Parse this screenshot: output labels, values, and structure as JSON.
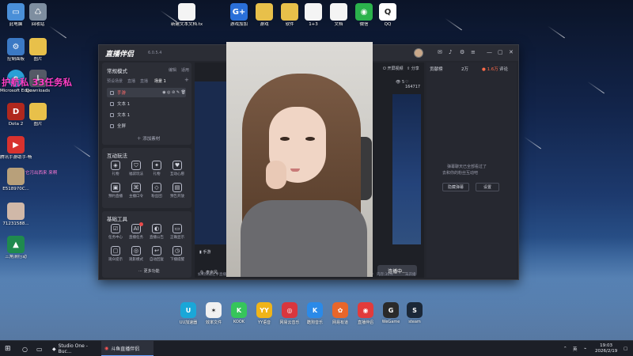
{
  "desktop": {
    "icons": [
      {
        "label": "此电脑",
        "color": "#4a8fd8"
      },
      {
        "label": "回收站",
        "color": "#c8d4e0"
      },
      {
        "label": "控制面板",
        "color": "#3b79c4"
      },
      {
        "label": "图片",
        "color": "#e8c04a"
      },
      {
        "label": "Microsoft Edge",
        "color": "#2a9fd6"
      },
      {
        "label": "Downloads",
        "color": "#555a66"
      },
      {
        "label": "Dota 2",
        "color": "#b0281e"
      },
      {
        "label": "图片",
        "color": "#e8c04a"
      },
      {
        "label": "腾讯手游助手-畅玩手机...",
        "color": "#d8322e"
      },
      {
        "label": "E518970C...",
        "color": "#b8a07a"
      },
      {
        "label": "71231588...",
        "color": "#d0b8a8"
      },
      {
        "label": "三角洲行动",
        "color": "#1f8a4e"
      },
      {
        "label": "新建文本文档.txt",
        "color": "#f4f4f4"
      },
      {
        "label": "游戏加加",
        "color": "#2a6fd8"
      },
      {
        "label": "游戏",
        "color": "#e8c04a"
      },
      {
        "label": "软件",
        "color": "#e8c04a"
      },
      {
        "label": "1+3",
        "color": "#f4f4f4"
      },
      {
        "label": "文档",
        "color": "#f4f4f4"
      },
      {
        "label": "微信",
        "color": "#2bb24c"
      },
      {
        "label": "QQ",
        "color": "#222222"
      }
    ],
    "overlay_text": "护航私 33任务私",
    "overlay_text_2": "它污出西来 来啊"
  },
  "window": {
    "app_name": "直播伴侣",
    "version": "6.0.5.4",
    "title_icons": [
      "message-icon",
      "bell-icon",
      "settings-icon",
      "menu-icon",
      "minimize-icon",
      "maximize-icon",
      "close-icon"
    ],
    "left": {
      "mode_label": "常规模式",
      "edit": "编辑",
      "layout": "适用",
      "scene_tabs": [
        "预设场景",
        "直播",
        "直播",
        "场景 1"
      ],
      "sources": [
        {
          "name": "手游",
          "selected": true
        },
        {
          "name": "文本 1",
          "selected": false
        },
        {
          "name": "文本 1",
          "selected": false
        },
        {
          "name": "全屏",
          "selected": false
        }
      ],
      "add_material": "添加素材",
      "interact_title": "互动玩法",
      "interact_tools": [
        "礼物",
        "福袋玩法",
        "礼物",
        "互动心愿",
        "预约直播",
        "主播口令",
        "粉丝团",
        "预告开放"
      ],
      "basic_title": "基础工具",
      "basic_tools": [
        "任务中心",
        "直播任务",
        "直播公告",
        "正确显示",
        "观众提示",
        "观影模式",
        "自动回复",
        "下播提醒"
      ],
      "more": "更多功能"
    },
    "center": {
      "top_right_labels": [
        "开屏视频",
        "分享"
      ],
      "viewer_count": "5",
      "like_count": "164717",
      "mic_label": "手游",
      "speaker_label": "麦克风",
      "go_live": "连播中...",
      "status": [
        "如何快速上手直播伴侣？",
        "码率：0kb/s",
        "FPS:60",
        "丢帧:0.00%",
        "CPU:8%",
        "内存:30%",
        "未开播"
      ]
    },
    "right": {
      "header": "贡献榜",
      "rank": "2万",
      "fans": "1.6万",
      "comments": "评论",
      "empty_msg": "弹幕聊天已全部看过了",
      "empty_msg_2": "去和你的粉丝互动吧",
      "btn_a": "隐藏弹幕",
      "btn_b": "设置"
    }
  },
  "dock": [
    {
      "label": "UU加速器",
      "color": "#1aa7d8"
    },
    {
      "label": "效率文件",
      "color": "#f1f1f1"
    },
    {
      "label": "KOOK",
      "color": "#36c55b"
    },
    {
      "label": "YY语音",
      "color": "#f0b418"
    },
    {
      "label": "网易云音乐",
      "color": "#d9363e"
    },
    {
      "label": "酷狗音乐",
      "color": "#2b8ae8"
    },
    {
      "label": "网易有道",
      "color": "#e8662a"
    },
    {
      "label": "直播伴侣",
      "color": "#e23b3b"
    },
    {
      "label": "WeGame",
      "color": "#2a2a2a"
    },
    {
      "label": "steam",
      "color": "#1b2838"
    }
  ],
  "taskbar": {
    "apps": [
      {
        "label": "Studio One - Buc...",
        "active": false
      },
      {
        "label": "斗鱼直播伴侣",
        "active": true
      }
    ],
    "lang": "英",
    "time": "19:03",
    "date": "2026/2/19"
  }
}
